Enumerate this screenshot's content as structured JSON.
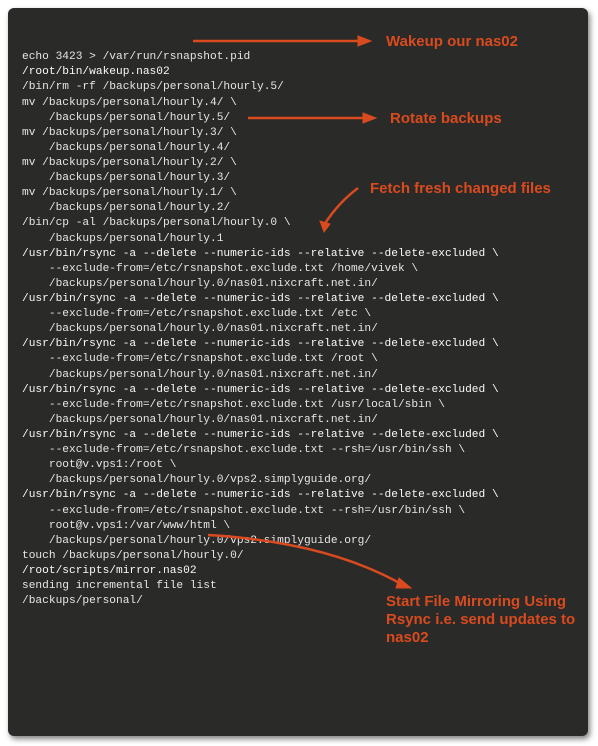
{
  "terminal": {
    "lines": [
      "echo 3423 > /var/run/rsnapshot.pid",
      "/root/bin/wakeup.nas02",
      "/bin/rm -rf /backups/personal/hourly.5/",
      "mv /backups/personal/hourly.4/ \\",
      "    /backups/personal/hourly.5/",
      "mv /backups/personal/hourly.3/ \\",
      "    /backups/personal/hourly.4/",
      "mv /backups/personal/hourly.2/ \\",
      "    /backups/personal/hourly.3/",
      "mv /backups/personal/hourly.1/ \\",
      "    /backups/personal/hourly.2/",
      "/bin/cp -al /backups/personal/hourly.0 \\",
      "    /backups/personal/hourly.1",
      "/usr/bin/rsync -a --delete --numeric-ids --relative --delete-excluded \\",
      "    --exclude-from=/etc/rsnapshot.exclude.txt /home/vivek \\",
      "    /backups/personal/hourly.0/nas01.nixcraft.net.in/",
      "/usr/bin/rsync -a --delete --numeric-ids --relative --delete-excluded \\",
      "    --exclude-from=/etc/rsnapshot.exclude.txt /etc \\",
      "    /backups/personal/hourly.0/nas01.nixcraft.net.in/",
      "/usr/bin/rsync -a --delete --numeric-ids --relative --delete-excluded \\",
      "    --exclude-from=/etc/rsnapshot.exclude.txt /root \\",
      "    /backups/personal/hourly.0/nas01.nixcraft.net.in/",
      "/usr/bin/rsync -a --delete --numeric-ids --relative --delete-excluded \\",
      "    --exclude-from=/etc/rsnapshot.exclude.txt /usr/local/sbin \\",
      "    /backups/personal/hourly.0/nas01.nixcraft.net.in/",
      "/usr/bin/rsync -a --delete --numeric-ids --relative --delete-excluded \\",
      "    --exclude-from=/etc/rsnapshot.exclude.txt --rsh=/usr/bin/ssh \\",
      "    root@v.vps1:/root \\",
      "    /backups/personal/hourly.0/vps2.simplyguide.org/",
      "/usr/bin/rsync -a --delete --numeric-ids --relative --delete-excluded \\",
      "    --exclude-from=/etc/rsnapshot.exclude.txt --rsh=/usr/bin/ssh \\",
      "    root@v.vps1:/var/www/html \\",
      "    /backups/personal/hourly.0/vps2.simplyguide.org/",
      "touch /backups/personal/hourly.0/",
      "/root/scripts/mirror.nas02",
      "sending incremental file list",
      "/backups/personal/"
    ],
    "highlight_indices": [
      1,
      34
    ],
    "rsync_start_indices": [
      13,
      16,
      19,
      22,
      25,
      29
    ]
  },
  "annotations": {
    "wakeup": "Wakeup our nas02",
    "rotate": "Rotate backups",
    "fetch": "Fetch fresh changed files",
    "mirror": "Start File Mirroring Using Rsync i.e. send updates to nas02"
  },
  "colors": {
    "bg": "#2a2a28",
    "fg": "#e6e6e6",
    "accent": "#d94a1f"
  }
}
